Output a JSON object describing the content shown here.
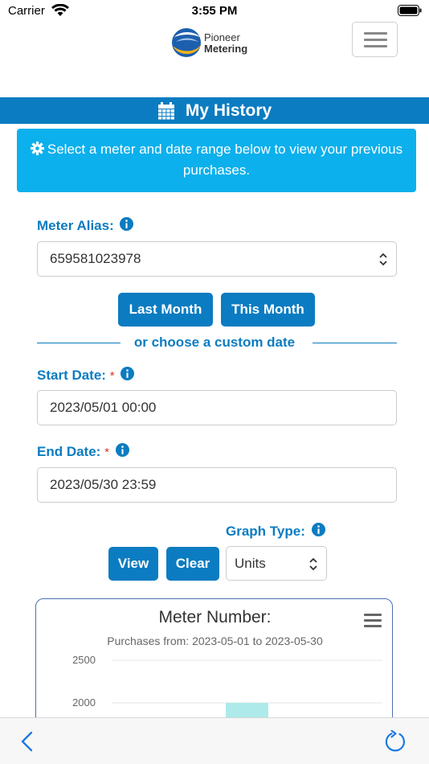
{
  "status_bar": {
    "carrier": "Carrier",
    "time": "3:55 PM"
  },
  "header": {
    "logo_line1": "Pioneer",
    "logo_line2": "Metering"
  },
  "page_title": "My History",
  "info_message": "Select a meter and date range below to view your previous purchases.",
  "form": {
    "meter_alias_label": "Meter Alias:",
    "meter_alias_value": "659581023978",
    "last_month_label": "Last Month",
    "this_month_label": "This Month",
    "custom_date_divider": "or choose a custom date",
    "start_date_label": "Start Date:",
    "start_date_value": "2023/05/01 00:00",
    "end_date_label": "End Date:",
    "end_date_value": "2023/05/30 23:59",
    "required_marker": "*",
    "graph_type_label": "Graph Type:",
    "graph_type_value": "Units",
    "view_label": "View",
    "clear_label": "Clear"
  },
  "chart_data": {
    "type": "bar",
    "title": "Meter Number:",
    "subtitle": "Purchases from: 2023-05-01 to 2023-05-30",
    "y_ticks": [
      2500,
      2000
    ],
    "ylim": [
      0,
      2500
    ],
    "grid": true,
    "bar_color": "#aeeaea",
    "values": [
      2000
    ]
  },
  "colors": {
    "primary": "#0b7cc1",
    "info": "#0bb0ec",
    "required": "#d9352b"
  }
}
